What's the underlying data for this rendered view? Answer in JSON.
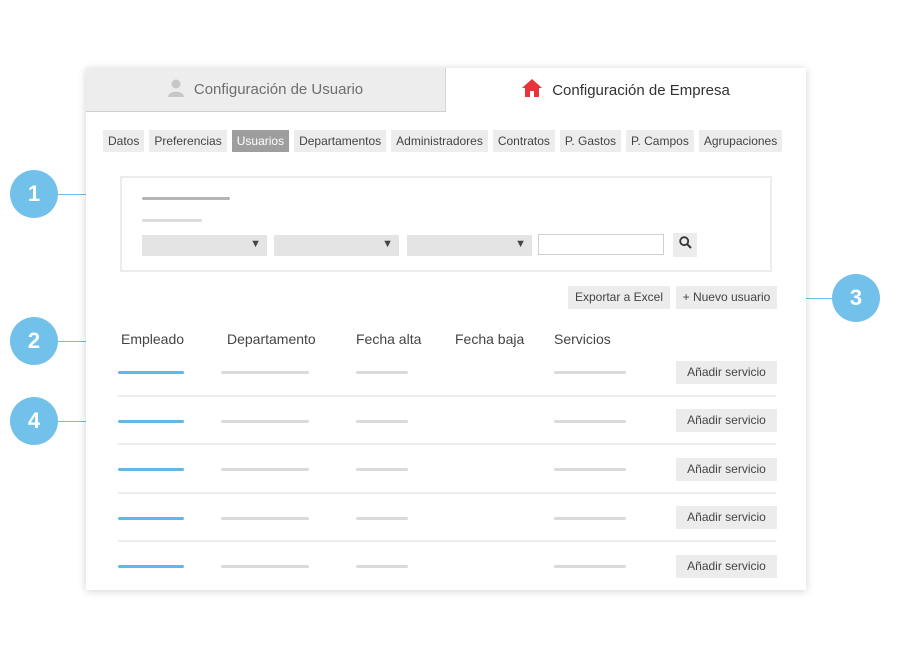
{
  "tabs": {
    "user": {
      "label": "Configuración de Usuario",
      "icon": "user-icon"
    },
    "company": {
      "label": "Configuración de Empresa",
      "icon": "home-icon",
      "icon_color": "#e8333a"
    }
  },
  "subnav": [
    "Datos",
    "Preferencias",
    "Usuarios",
    "Departamentos",
    "Administradores",
    "Contratos",
    "P. Gastos",
    "P. Campos",
    "Agrupaciones"
  ],
  "subnav_active": "Usuarios",
  "actions": {
    "export": "Exportar a Excel",
    "new_user": "+ Nuevo usuario"
  },
  "table": {
    "headers": {
      "employee": "Empleado",
      "department": "Departamento",
      "start": "Fecha alta",
      "end": "Fecha baja",
      "services": "Servicios"
    },
    "row_button": "Añadir servicio",
    "row_count": 5
  },
  "annotations": [
    "1",
    "2",
    "3",
    "4"
  ],
  "colors": {
    "accent": "#72c1ea",
    "active_tab": "#9e9e9e",
    "home_icon": "#e8333a"
  }
}
